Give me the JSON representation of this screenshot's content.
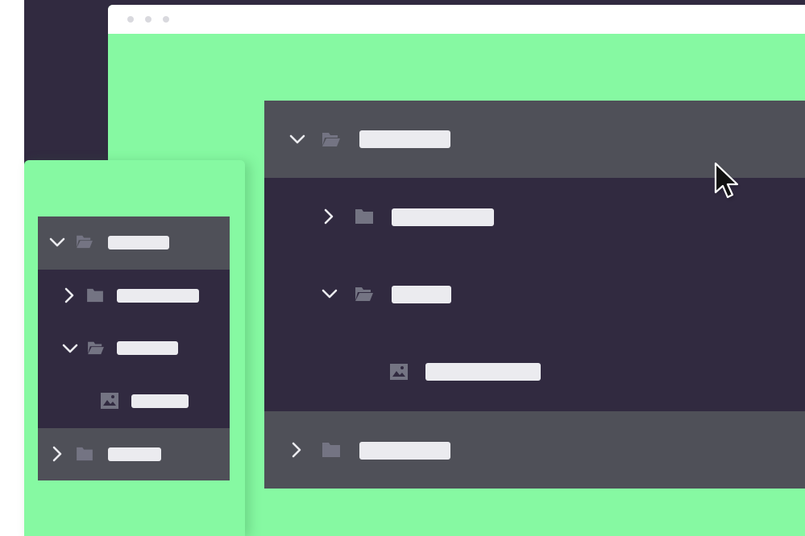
{
  "colors": {
    "green": "#86f9a2",
    "dark": "#312a40",
    "row_highlight": "#4f5058",
    "placeholder_bar": "#ebebef",
    "icon": "#747483"
  },
  "browser_window": {
    "traffic_light_icons": [
      "dot",
      "dot",
      "dot"
    ]
  },
  "large_tree": {
    "rows": [
      {
        "level": 0,
        "state": "expanded",
        "icon": "folder-open-icon",
        "highlighted": true
      },
      {
        "level": 1,
        "state": "collapsed",
        "icon": "folder-icon",
        "highlighted": false
      },
      {
        "level": 1,
        "state": "expanded",
        "icon": "folder-open-icon",
        "highlighted": false
      },
      {
        "level": 2,
        "state": "leaf",
        "icon": "image-file-icon",
        "highlighted": false
      },
      {
        "level": 0,
        "state": "collapsed",
        "icon": "folder-icon",
        "highlighted": true
      }
    ]
  },
  "small_tree": {
    "rows": [
      {
        "level": 0,
        "state": "expanded",
        "icon": "folder-open-icon",
        "highlighted": true
      },
      {
        "level": 1,
        "state": "collapsed",
        "icon": "folder-icon",
        "highlighted": false
      },
      {
        "level": 1,
        "state": "expanded",
        "icon": "folder-open-icon",
        "highlighted": false
      },
      {
        "level": 2,
        "state": "leaf",
        "icon": "image-file-icon",
        "highlighted": false
      },
      {
        "level": 0,
        "state": "collapsed",
        "icon": "folder-icon",
        "highlighted": true
      }
    ]
  },
  "cursor_icon": "arrow-pointer-icon"
}
